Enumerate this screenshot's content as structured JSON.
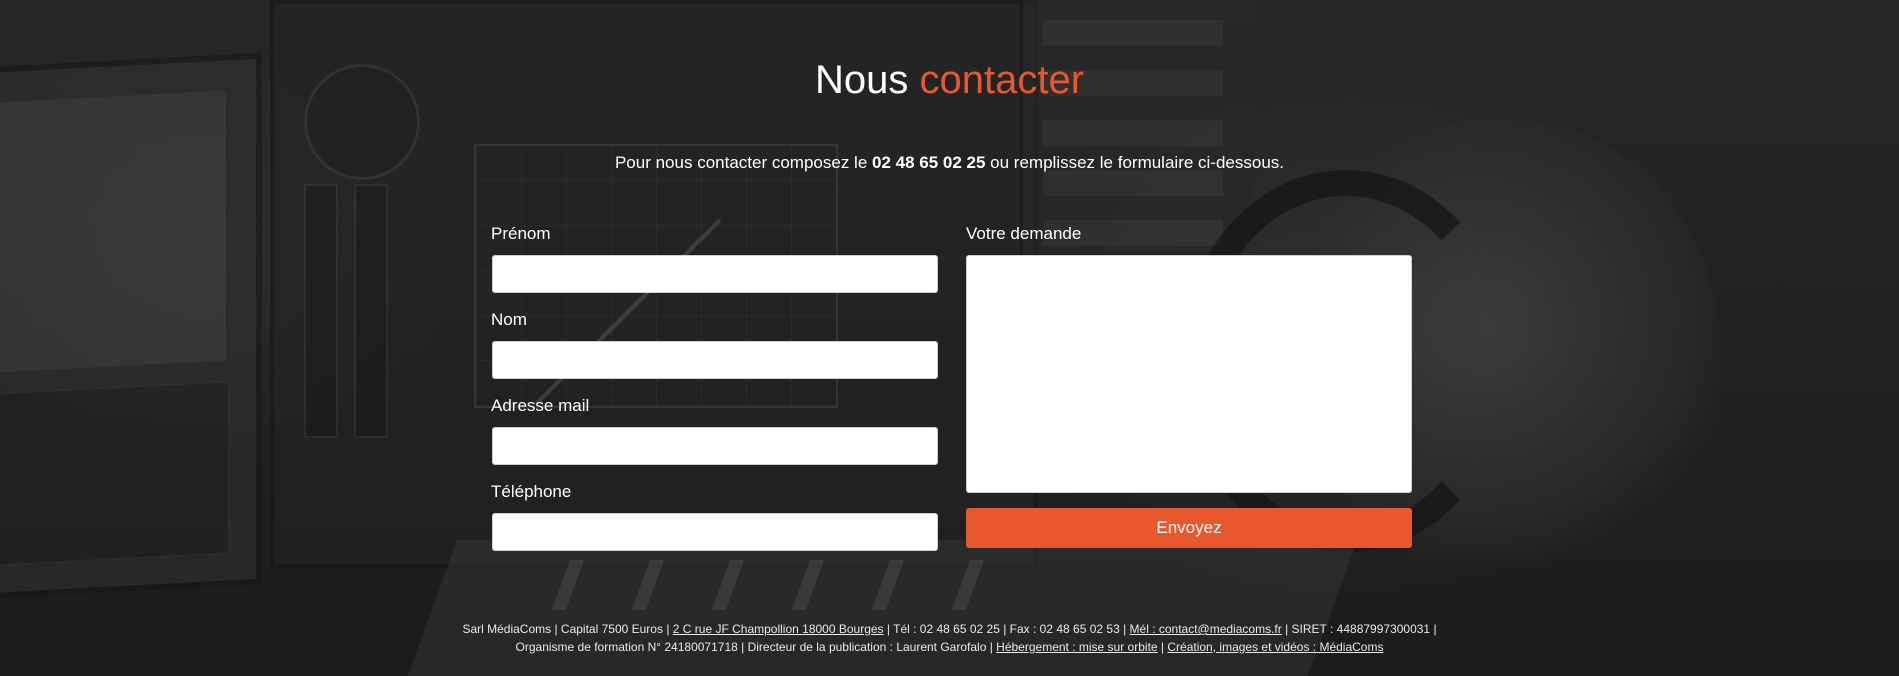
{
  "heading": {
    "prefix": "Nous",
    "accent": "contacter"
  },
  "intro": {
    "before": "Pour nous contacter composez le ",
    "phone": "02 48 65 02 25",
    "after": " ou remplissez le formulaire ci-dessous."
  },
  "form": {
    "prenom_label": "Prénom",
    "prenom_value": "",
    "nom_label": "Nom",
    "nom_value": "",
    "email_label": "Adresse mail",
    "email_value": "",
    "telephone_label": "Téléphone",
    "telephone_value": "",
    "demande_label": "Votre demande",
    "demande_value": "",
    "submit_label": "Envoyez"
  },
  "footer": {
    "line1_text1": "Sarl MédiaComs | Capital 7500 Euros | ",
    "address_link": "2 C rue JF Champollion 18000 Bourges",
    "line1_text2": " | Tél : 02 48 65 02 25 | Fax : 02 48 65 02 53 | ",
    "mail_link": "Mél : contact@mediacoms.fr",
    "line1_text3": " | SIRET : 44887997300031 |",
    "line2_text1": "Organisme de formation N° 24180071718 | Directeur de la publication : Laurent Garofalo | ",
    "hosting_link": "Hébergement : mise sur orbite",
    "line2_sep": " | ",
    "credits_link": "Création, images et vidéos : MédiaComs"
  },
  "colors": {
    "accent": "#e8582e",
    "text": "#ffffff",
    "background": "#2b2b2b"
  }
}
